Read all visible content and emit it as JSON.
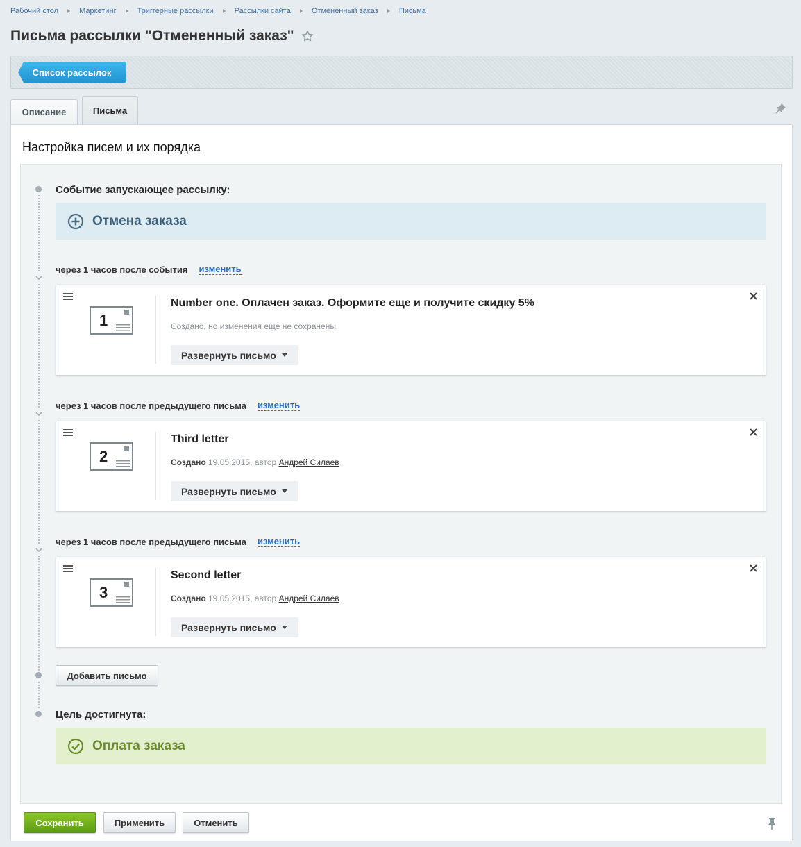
{
  "breadcrumb": [
    "Рабочий стол",
    "Маркетинг",
    "Триггерные рассылки",
    "Рассылки сайта",
    "Отмененный заказ",
    "Письма"
  ],
  "page_title": "Письма рассылки \"Отмененный заказ\"",
  "toolbar": {
    "list_button": "Список рассылок"
  },
  "tabs": [
    {
      "label": "Описание"
    },
    {
      "label": "Письма"
    }
  ],
  "section_title": "Настройка писем и их порядка",
  "trigger": {
    "label": "Событие запускающее рассылку:",
    "event": "Отмена заказа"
  },
  "delays": [
    {
      "text": "через 1 часов после  события",
      "link": "изменить"
    },
    {
      "text": "через 1 часов после  предыдущего письма",
      "link": "изменить"
    },
    {
      "text": "через 1 часов после  предыдущего письма",
      "link": "изменить"
    }
  ],
  "letters": [
    {
      "number": "1",
      "title": "Number one. Оплачен заказ. Оформите еще и получите скидку 5%",
      "status": "Создано, но изменения еще не сохранены",
      "expand": "Развернуть письмо"
    },
    {
      "number": "2",
      "title": "Third letter",
      "created_label": "Создано",
      "created_rest": " 19.05.2015, автор ",
      "author": "Андрей Силаев",
      "expand": "Развернуть письмо"
    },
    {
      "number": "3",
      "title": "Second letter",
      "created_label": "Создано",
      "created_rest": " 19.05.2015, автор ",
      "author": "Андрей Силаев",
      "expand": "Развернуть письмо"
    }
  ],
  "add_letter": "Добавить письмо",
  "goal": {
    "label": "Цель достигнута:",
    "event": "Оплата заказа"
  },
  "footer": {
    "save": "Сохранить",
    "apply": "Применить",
    "cancel": "Отменить"
  },
  "icons": {
    "breadcrumb_separator": "triangle-right-icon",
    "favorite": "star-icon",
    "pin": "pin-icon",
    "trigger": "plus-circle-icon",
    "goal": "check-circle-icon",
    "drag": "drag-handle-icon",
    "envelope": "envelope-icon",
    "close": "close-icon",
    "dropdown": "caret-down-icon",
    "timeline": "chevron-down-icon"
  },
  "colors": {
    "primary_blue": "#1f95d3",
    "save_green": "#5b9d13",
    "trigger_bg": "#ddebf3",
    "goal_bg": "#e3f0ce",
    "link": "#2a6ebb"
  }
}
